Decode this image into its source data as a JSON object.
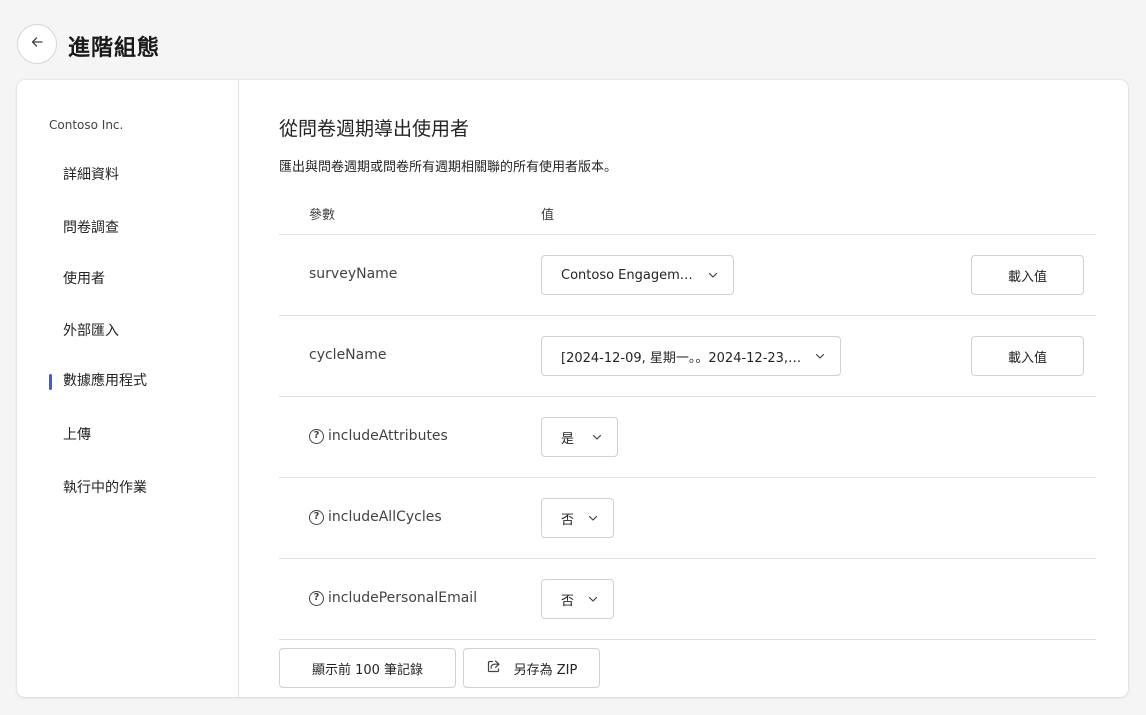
{
  "header": {
    "title": "進階組態",
    "back_icon": "arrow-left-icon"
  },
  "sidebar": {
    "org": "Contoso Inc.",
    "items": [
      {
        "label": "詳細資料"
      },
      {
        "label": "問卷調查"
      },
      {
        "label": "使用者"
      },
      {
        "label": "外部匯入"
      },
      {
        "label": "數據應用程式",
        "selected": true
      },
      {
        "label": "上傳"
      },
      {
        "label": "執行中的作業"
      }
    ]
  },
  "main": {
    "title": "從問卷週期導出使用者",
    "description": "匯出與問卷週期或問卷所有週期相關聯的所有使用者版本。",
    "col_param": "參數",
    "col_value": "值",
    "rows": [
      {
        "name": "surveyName",
        "value": "Contoso Engagement",
        "action": "載入值"
      },
      {
        "name": "cycleName",
        "value": "[2024-12-09, 星期一。。2024-12-23, ...",
        "action": "載入值"
      },
      {
        "name": "includeAttributes",
        "value": "是"
      },
      {
        "name": "includeAllCycles",
        "value": "否"
      },
      {
        "name": "includePersonalEmail",
        "value": "否"
      }
    ],
    "show_records": "顯示前 100 筆記錄",
    "save_zip": "另存為 ZIP"
  },
  "colors": {
    "accent": "#3b5bdb",
    "border": "#d1d1d1",
    "divider": "#e0e0e0"
  }
}
